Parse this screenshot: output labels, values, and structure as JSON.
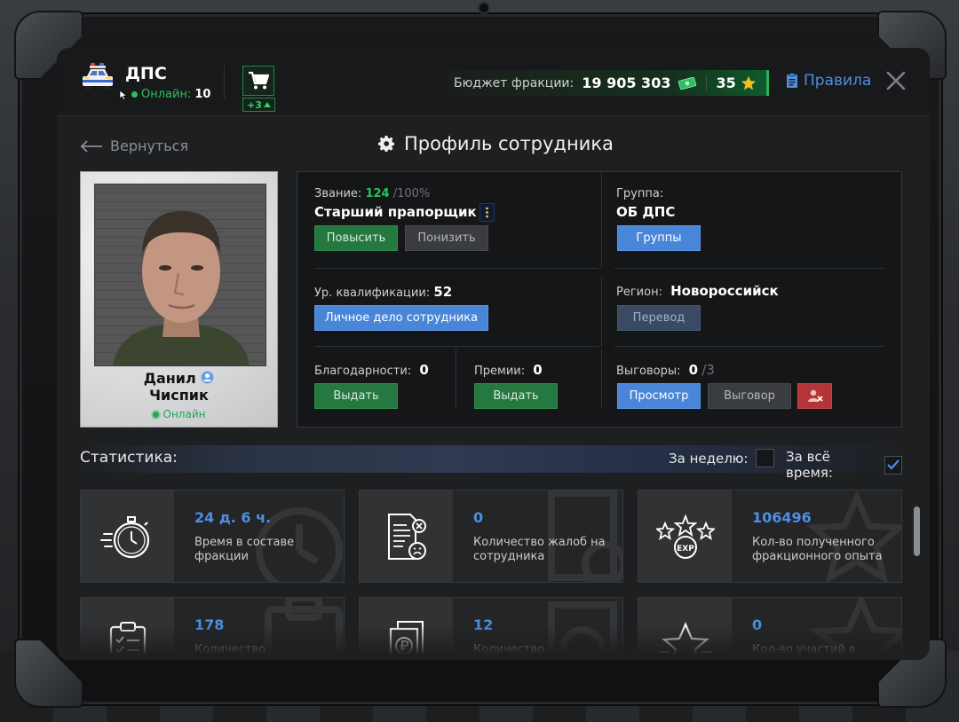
{
  "header": {
    "faction_name": "ДПС",
    "online_label": "Онлайн:",
    "online_count": "10",
    "cart_badge": "+3",
    "budget_label": "Бюджет фракции:",
    "budget_value": "19 905 303",
    "stars_value": "35",
    "rules_label": "Правила"
  },
  "nav": {
    "back_label": "Вернуться",
    "page_title": "Профиль сотрудника"
  },
  "employee": {
    "first_name": "Данил",
    "last_name": "Чиспик",
    "status": "Онлайн"
  },
  "profile": {
    "rank_label": "Звание:",
    "rank_progress": "124",
    "rank_progress_max": "/100%",
    "rank_name": "Старший прапорщик",
    "promote_btn": "Повысить",
    "demote_btn": "Понизить",
    "group_label": "Группа:",
    "group_name": "ОБ ДПС",
    "groups_btn": "Группы",
    "qualification_label": "Ур. квалификации:",
    "qualification_value": "52",
    "personal_file_btn": "Личное дело сотрудника",
    "region_label": "Регион:",
    "region_value": "Новороссийск",
    "transfer_btn": "Перевод",
    "thanks_label": "Благодарности:",
    "thanks_value": "0",
    "thanks_btn": "Выдать",
    "bonus_label": "Премии:",
    "bonus_value": "0",
    "bonus_btn": "Выдать",
    "reprimands_label": "Выговоры:",
    "reprimands_value": "0",
    "reprimands_max": "/3",
    "view_btn": "Просмотр",
    "reprimand_btn": "Выговор"
  },
  "stats": {
    "title": "Статистика:",
    "week_label": "За неделю:",
    "alltime_label": "За всё время:",
    "week_checked": false,
    "alltime_checked": true,
    "cards": [
      {
        "icon": "stopwatch-icon",
        "value": "24 д. 6 ч.",
        "desc": "Время в составе фракции"
      },
      {
        "icon": "complaint-document-icon",
        "value": "0",
        "desc": "Количество жалоб на сотрудника"
      },
      {
        "icon": "exp-stars-icon",
        "value": "106496",
        "desc": "Кол-во полученного фракционного опыта"
      },
      {
        "icon": "clipboard-checklist-icon",
        "value": "178",
        "desc": "Количество"
      },
      {
        "icon": "ruble-documents-icon",
        "value": "12",
        "desc": "Количество"
      },
      {
        "icon": "star-icon",
        "value": "0",
        "desc": "Кол-во участий в"
      }
    ]
  },
  "colors": {
    "accent_blue": "#4d8fe3",
    "online_green": "#27c25d",
    "button_green": "#25783f",
    "button_blue": "#4a86d8",
    "button_red": "#b43537"
  }
}
